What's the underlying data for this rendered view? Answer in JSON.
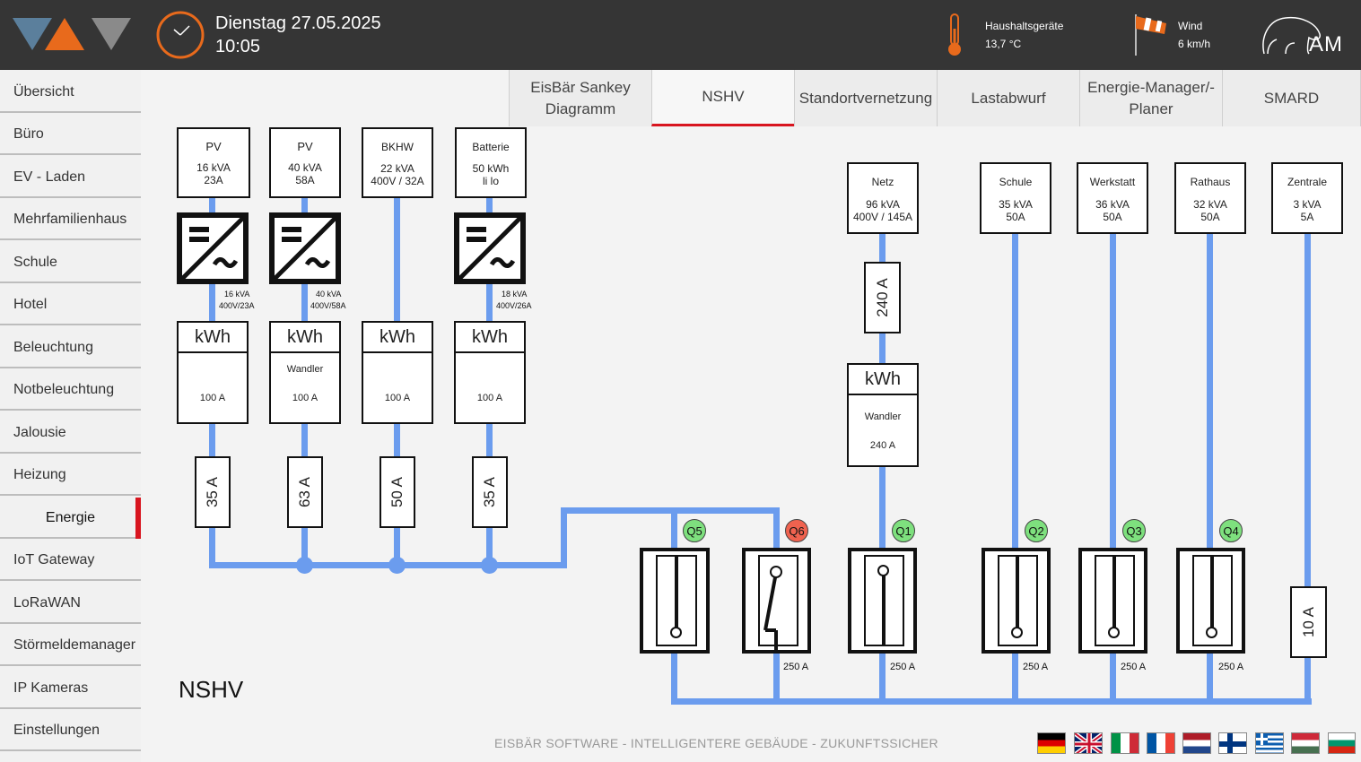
{
  "header": {
    "date": "Dienstag 27.05.2025",
    "time": "10:05",
    "sensor1_label": "Haushaltsgeräte",
    "sensor1_value": "13,7 °C",
    "sensor2_label": "Wind",
    "sensor2_value": "6 km/h",
    "brand_text": "AM"
  },
  "sidebar": {
    "items": [
      {
        "label": "Übersicht"
      },
      {
        "label": "Büro"
      },
      {
        "label": "EV - Laden"
      },
      {
        "label": "Mehrfamilienhaus"
      },
      {
        "label": "Schule"
      },
      {
        "label": "Hotel"
      },
      {
        "label": "Beleuchtung"
      },
      {
        "label": "Notbeleuchtung"
      },
      {
        "label": "Jalousie"
      },
      {
        "label": "Heizung"
      },
      {
        "label": "Energie"
      },
      {
        "label": "IoT Gateway"
      },
      {
        "label": "LoRaWAN"
      },
      {
        "label": "Störmeldemanager"
      },
      {
        "label": "IP Kameras"
      },
      {
        "label": "Einstellungen"
      }
    ],
    "active": "Energie"
  },
  "tabs": [
    {
      "label": "EisBär Sankey Diagramm"
    },
    {
      "label": "NSHV"
    },
    {
      "label": "Standortvernetzung"
    },
    {
      "label": "Lastabwurf"
    },
    {
      "label": "Energie-Manager/-Planer"
    },
    {
      "label": "SMARD"
    }
  ],
  "diagram": {
    "title": "NSHV",
    "sources": [
      {
        "name": "PV",
        "l1": "16 kVA",
        "l2": "23A",
        "inv1": "16 kVA",
        "inv2": "400V/23A",
        "meter_mid": "",
        "meter_bottom": "100 A",
        "fuse": "35 A"
      },
      {
        "name": "PV",
        "l1": "40 kVA",
        "l2": "58A",
        "inv1": "40 kVA",
        "inv2": "400V/58A",
        "meter_mid": "Wandler",
        "meter_bottom": "100 A",
        "fuse": "63 A"
      },
      {
        "name": "BKHW",
        "l1": "22 kVA",
        "l2": "400V / 32A",
        "meter_mid": "",
        "meter_bottom": "100 A",
        "fuse": "50 A"
      },
      {
        "name": "Batterie",
        "l1": "50 kWh",
        "l2": "li lo",
        "inv1": "18 kVA",
        "inv2": "400V/26A",
        "meter_mid": "",
        "meter_bottom": "100 A",
        "fuse": "35 A"
      }
    ],
    "meter_label": "kWh",
    "grid": {
      "name": "Netz",
      "l1": "96 kVA",
      "l2": "400V / 145A",
      "fuse": "240 A",
      "meter_mid": "Wandler",
      "meter_bottom": "240 A"
    },
    "loads": [
      {
        "name": "Schule",
        "l1": "35 kVA",
        "l2": "50A"
      },
      {
        "name": "Werkstatt",
        "l1": "36 kVA",
        "l2": "50A"
      },
      {
        "name": "Rathaus",
        "l1": "32 kVA",
        "l2": "50A"
      },
      {
        "name": "Zentrale",
        "l1": "3 kVA",
        "l2": "5A"
      }
    ],
    "zentrale_fuse": "10 A",
    "breakers": [
      {
        "id": "Q5",
        "state": "closed",
        "color": "#7ee07e",
        "rating": ""
      },
      {
        "id": "Q6",
        "state": "open",
        "color": "#f0624f",
        "rating": "250 A"
      },
      {
        "id": "Q1",
        "state": "closed",
        "color": "#7ee07e",
        "rating": "250 A"
      },
      {
        "id": "Q2",
        "state": "closed",
        "color": "#7ee07e",
        "rating": "250 A"
      },
      {
        "id": "Q3",
        "state": "closed",
        "color": "#7ee07e",
        "rating": "250 A"
      },
      {
        "id": "Q4",
        "state": "closed",
        "color": "#7ee07e",
        "rating": "250 A"
      }
    ]
  },
  "footer": {
    "text": "EISBÄR SOFTWARE - INTELLIGENTERE GEBÄUDE - ZUKUNFTSSICHER",
    "languages": [
      "de-flag-icon",
      "uk-flag-icon",
      "it-flag-icon",
      "fr-flag-icon",
      "nl-flag-icon",
      "fi-flag-icon",
      "gr-flag-icon",
      "hu-flag-icon",
      "bg-flag-icon"
    ]
  },
  "colors": {
    "accent": "#d8151f",
    "bus": "#6b9cee",
    "logo_orange": "#e86a1c",
    "logo_blue": "#5b7f9c"
  }
}
